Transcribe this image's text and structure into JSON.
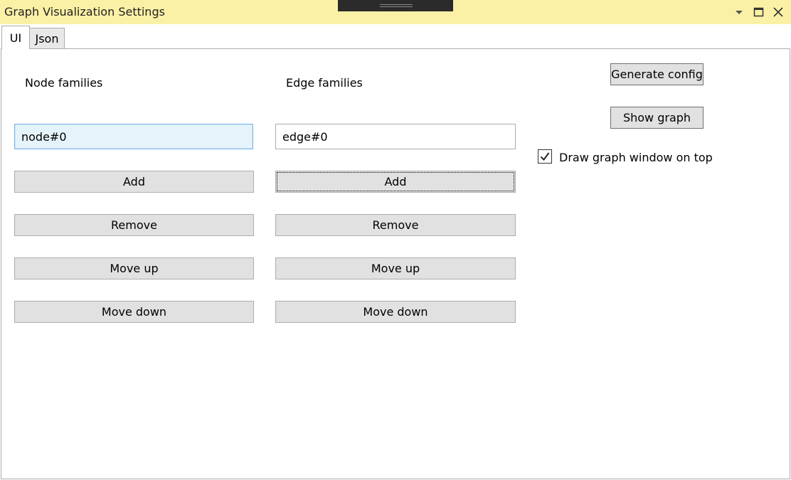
{
  "window": {
    "title": "Graph Visualization Settings",
    "controls": [
      "chevron-down-icon",
      "maximize-icon",
      "close-icon"
    ]
  },
  "tabs": [
    {
      "label": "UI",
      "selected": true
    },
    {
      "label": "Json",
      "selected": false
    }
  ],
  "node_panel": {
    "heading": "Node families",
    "input_value": "node#0",
    "buttons": {
      "add": "Add",
      "remove": "Remove",
      "move_up": "Move up",
      "move_down": "Move down"
    }
  },
  "edge_panel": {
    "heading": "Edge families",
    "input_value": "edge#0",
    "buttons": {
      "add": "Add",
      "remove": "Remove",
      "move_up": "Move up",
      "move_down": "Move down"
    }
  },
  "actions": {
    "generate_config": "Generate config",
    "show_graph": "Show graph",
    "draw_on_top": {
      "label": "Draw graph window on top",
      "checked": true
    }
  }
}
